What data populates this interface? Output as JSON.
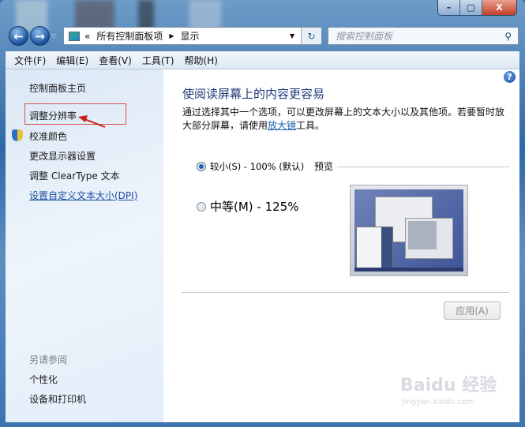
{
  "window": {
    "minimize": "–",
    "maximize": "□",
    "close": "X"
  },
  "address": {
    "prefix": "«",
    "crumbs": [
      "所有控制面板项",
      "显示"
    ]
  },
  "search": {
    "placeholder": "搜索控制面板"
  },
  "menu": [
    "文件(F)",
    "编辑(E)",
    "查看(V)",
    "工具(T)",
    "帮助(H)"
  ],
  "sidebar": {
    "items": [
      {
        "label": "控制面板主页"
      },
      {
        "label": "调整分辨率"
      },
      {
        "label": "校准颜色"
      },
      {
        "label": "更改显示器设置"
      },
      {
        "label": "调整 ClearType 文本"
      },
      {
        "label": "设置自定义文本大小(DPI)"
      }
    ],
    "see_also_title": "另请参阅",
    "see_also": [
      "个性化",
      "设备和打印机"
    ]
  },
  "main": {
    "title": "使阅读屏幕上的内容更容易",
    "desc_before": "通过选择其中一个选项，可以更改屏幕上的文本大小以及其他项。若要暂时放大部分屏幕，请使用",
    "desc_link": "放大镜",
    "desc_after": "工具。",
    "options": [
      {
        "label": "较小(S) - 100% (默认)",
        "selected": true
      },
      {
        "label": "中等(M) - 125%",
        "selected": false
      }
    ],
    "preview_label": "预览",
    "apply": "应用(A)"
  },
  "watermark": {
    "brand": "Baidu 经验",
    "url": "jingyan.baidu.com"
  }
}
